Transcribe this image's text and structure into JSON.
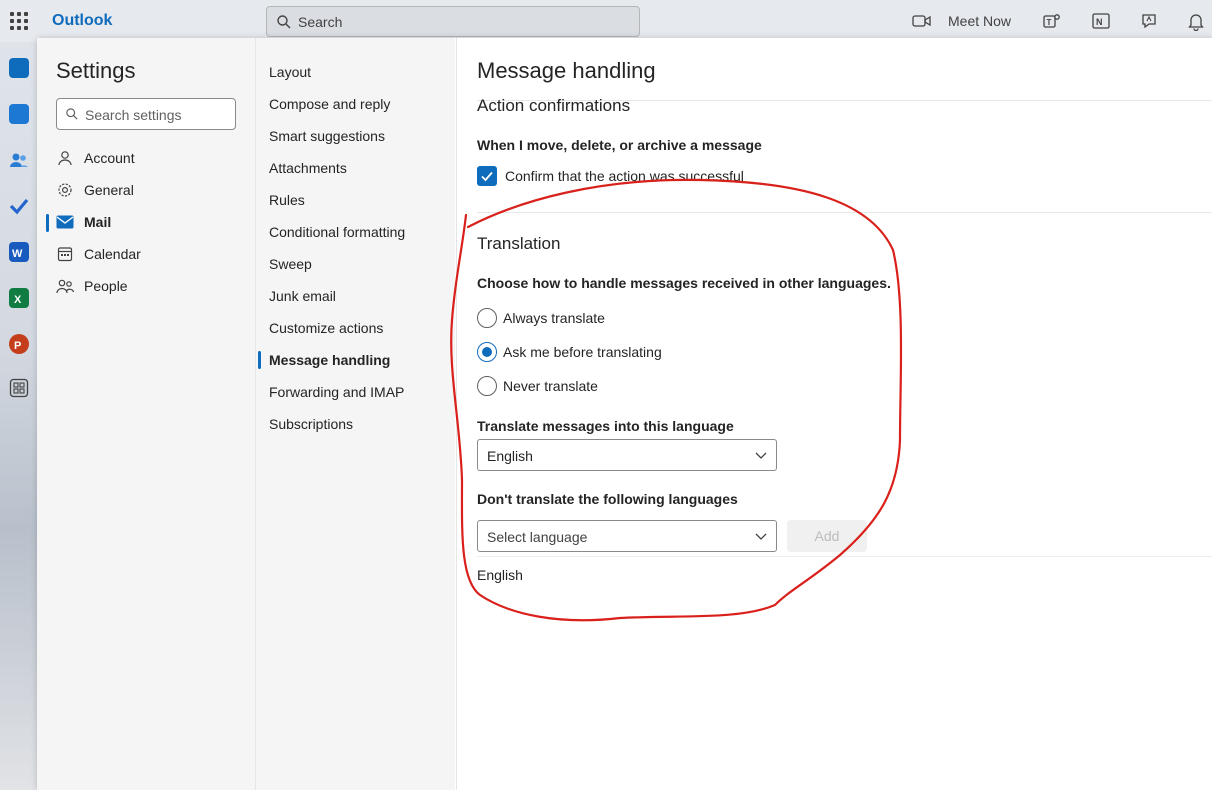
{
  "topbar": {
    "app_name": "Outlook",
    "search_placeholder": "Search",
    "meet_now_label": "Meet Now"
  },
  "rail": {
    "apps": [
      "mail-icon",
      "calendar-icon",
      "people-icon",
      "todo-icon",
      "word-icon",
      "excel-icon",
      "powerpoint-icon",
      "more-apps-icon"
    ]
  },
  "settings": {
    "title": "Settings",
    "search_placeholder": "Search settings",
    "categories": [
      {
        "label": "Account",
        "icon": "person-icon"
      },
      {
        "label": "General",
        "icon": "gear-icon"
      },
      {
        "label": "Mail",
        "icon": "mail-icon",
        "active": true
      },
      {
        "label": "Calendar",
        "icon": "calendar-icon"
      },
      {
        "label": "People",
        "icon": "people-icon"
      }
    ],
    "mail_items": [
      {
        "label": "Layout"
      },
      {
        "label": "Compose and reply"
      },
      {
        "label": "Smart suggestions"
      },
      {
        "label": "Attachments"
      },
      {
        "label": "Rules"
      },
      {
        "label": "Conditional formatting"
      },
      {
        "label": "Sweep"
      },
      {
        "label": "Junk email"
      },
      {
        "label": "Customize actions"
      },
      {
        "label": "Message handling",
        "active": true
      },
      {
        "label": "Forwarding and IMAP"
      },
      {
        "label": "Subscriptions"
      }
    ]
  },
  "content": {
    "title": "Message handling",
    "action_confirmations": {
      "heading": "Action confirmations",
      "subheading": "When I move, delete, or archive a message",
      "checkbox_label": "Confirm that the action was successful",
      "checked": true
    },
    "translation": {
      "heading": "Translation",
      "description": "Choose how to handle messages received in other languages.",
      "options": [
        {
          "label": "Always translate",
          "checked": false
        },
        {
          "label": "Ask me before translating",
          "checked": true
        },
        {
          "label": "Never translate",
          "checked": false
        }
      ],
      "translate_into_label": "Translate messages into this language",
      "translate_into_value": "English",
      "dont_translate_label": "Don't translate the following languages",
      "select_placeholder": "Select language",
      "add_label": "Add",
      "excluded_languages": [
        "English"
      ]
    }
  },
  "colors": {
    "accent": "#0f6cbd",
    "annotation": "#d9201b"
  }
}
